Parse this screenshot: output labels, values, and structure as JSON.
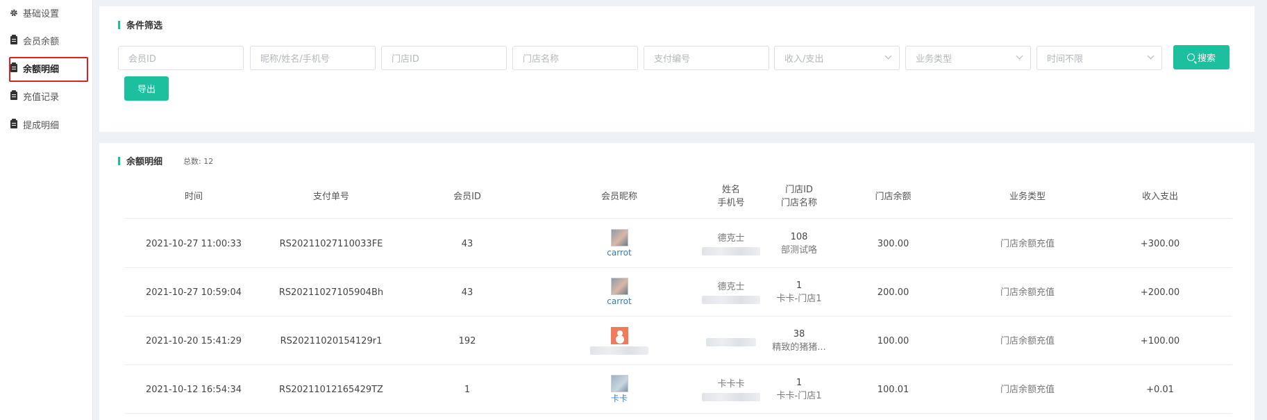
{
  "sidebar": {
    "items": [
      {
        "label": "基础设置",
        "icon": "gear-icon",
        "active": false
      },
      {
        "label": "会员余额",
        "icon": "clipboard-icon",
        "active": false
      },
      {
        "label": "余额明细",
        "icon": "clipboard-icon",
        "active": true
      },
      {
        "label": "充值记录",
        "icon": "clipboard-icon",
        "active": false
      },
      {
        "label": "提成明细",
        "icon": "clipboard-icon",
        "active": false
      }
    ]
  },
  "filter": {
    "title": "条件筛选",
    "member_id_placeholder": "会员ID",
    "name_placeholder": "昵称/姓名/手机号",
    "store_id_placeholder": "门店ID",
    "store_name_placeholder": "门店名称",
    "pay_no_placeholder": "支付编号",
    "income_expense_placeholder": "收入/支出",
    "business_type_placeholder": "业务类型",
    "time_placeholder": "时间不限",
    "search_label": "搜索",
    "export_label": "导出"
  },
  "list": {
    "title": "余额明细",
    "total_label": "总数: 12",
    "headers": {
      "time": "时间",
      "pay_no": "支付单号",
      "member_id": "会员ID",
      "nickname": "会员昵称",
      "name_line1": "姓名",
      "name_line2": "手机号",
      "store_line1": "门店ID",
      "store_line2": "门店名称",
      "store_balance": "门店余额",
      "business_type": "业务类型",
      "income_expense": "收入支出"
    },
    "rows": [
      {
        "time": "2021-10-27 11:00:33",
        "pay_no": "RS20211027110033FE",
        "member_id": "43",
        "nickname": "carrot",
        "name": "德克士",
        "store_id": "108",
        "store_name": "部测试咯",
        "store_balance": "300.00",
        "business_type": "门店余额充值",
        "amount": "+300.00"
      },
      {
        "time": "2021-10-27 10:59:04",
        "pay_no": "RS20211027105904Bh",
        "member_id": "43",
        "nickname": "carrot",
        "name": "德克士",
        "store_id": "1",
        "store_name": "卡卡-门店1",
        "store_balance": "200.00",
        "business_type": "门店余额充值",
        "amount": "+200.00"
      },
      {
        "time": "2021-10-20 15:41:29",
        "pay_no": "RS20211020154129r1",
        "member_id": "192",
        "nickname": "",
        "name": "",
        "store_id": "38",
        "store_name": "精致的猪猪...",
        "store_balance": "100.00",
        "business_type": "门店余额充值",
        "amount": "+100.00"
      },
      {
        "time": "2021-10-12 16:54:34",
        "pay_no": "RS20211012165429TZ",
        "member_id": "1",
        "nickname": "卡卡",
        "name": "卡卡卡",
        "store_id": "1",
        "store_name": "卡卡-门店1",
        "store_balance": "100.01",
        "business_type": "门店余额充值",
        "amount": "+0.01"
      }
    ]
  },
  "colors": {
    "accent": "#1cc09f",
    "highlight_box": "#e02020",
    "link": "#2f7db7"
  }
}
